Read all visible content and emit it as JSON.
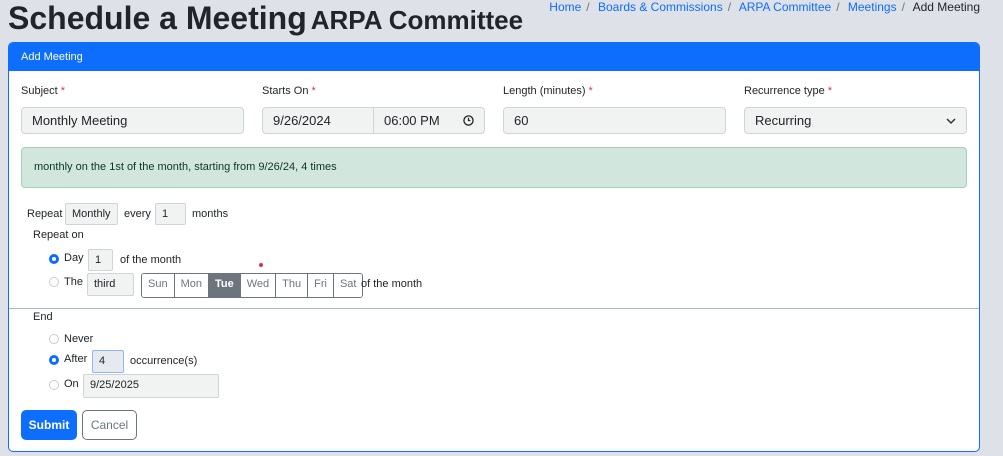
{
  "page": {
    "title": "Schedule a Meeting",
    "subtitle": "ARPA Committee"
  },
  "breadcrumb": {
    "items": [
      "Home",
      "Boards & Commissions",
      "ARPA Committee",
      "Meetings"
    ],
    "active": "Add Meeting"
  },
  "card": {
    "header": "Add Meeting"
  },
  "form": {
    "subject": {
      "label": "Subject",
      "required": "*",
      "value": "Monthly Meeting"
    },
    "starts_on": {
      "label": "Starts On",
      "required": "*",
      "date": "9/26/2024",
      "time": "06:00 PM"
    },
    "length": {
      "label": "Length (minutes)",
      "required": "*",
      "value": "60"
    },
    "recurrence": {
      "label": "Recurrence type",
      "required": "*",
      "value": "Recurring"
    }
  },
  "summary": "monthly on the 1st of the month, starting from 9/26/24, 4 times",
  "repeat": {
    "label": "Repeat",
    "frequency": "Monthly",
    "every_label": "every",
    "every_value": "1",
    "unit": "months"
  },
  "repeat_on": {
    "label": "Repeat on",
    "day_label": "Day",
    "day_value": "1",
    "day_suffix": "of the month",
    "the_label": "The",
    "ordinal": "third",
    "weekdays": [
      "Sun",
      "Mon",
      "Tue",
      "Wed",
      "Thu",
      "Fri",
      "Sat"
    ],
    "selected_weekday": "Tue",
    "the_suffix": "of the month"
  },
  "end": {
    "label": "End",
    "never_label": "Never",
    "after_label": "After",
    "after_value": "4",
    "after_suffix": "occurrence(s)",
    "on_label": "On",
    "on_value": "9/25/2025"
  },
  "buttons": {
    "submit": "Submit",
    "cancel": "Cancel"
  },
  "colors": {
    "primary": "#0d6efd",
    "summary_bg": "#d1e7dd",
    "secondary": "#6c757d"
  }
}
